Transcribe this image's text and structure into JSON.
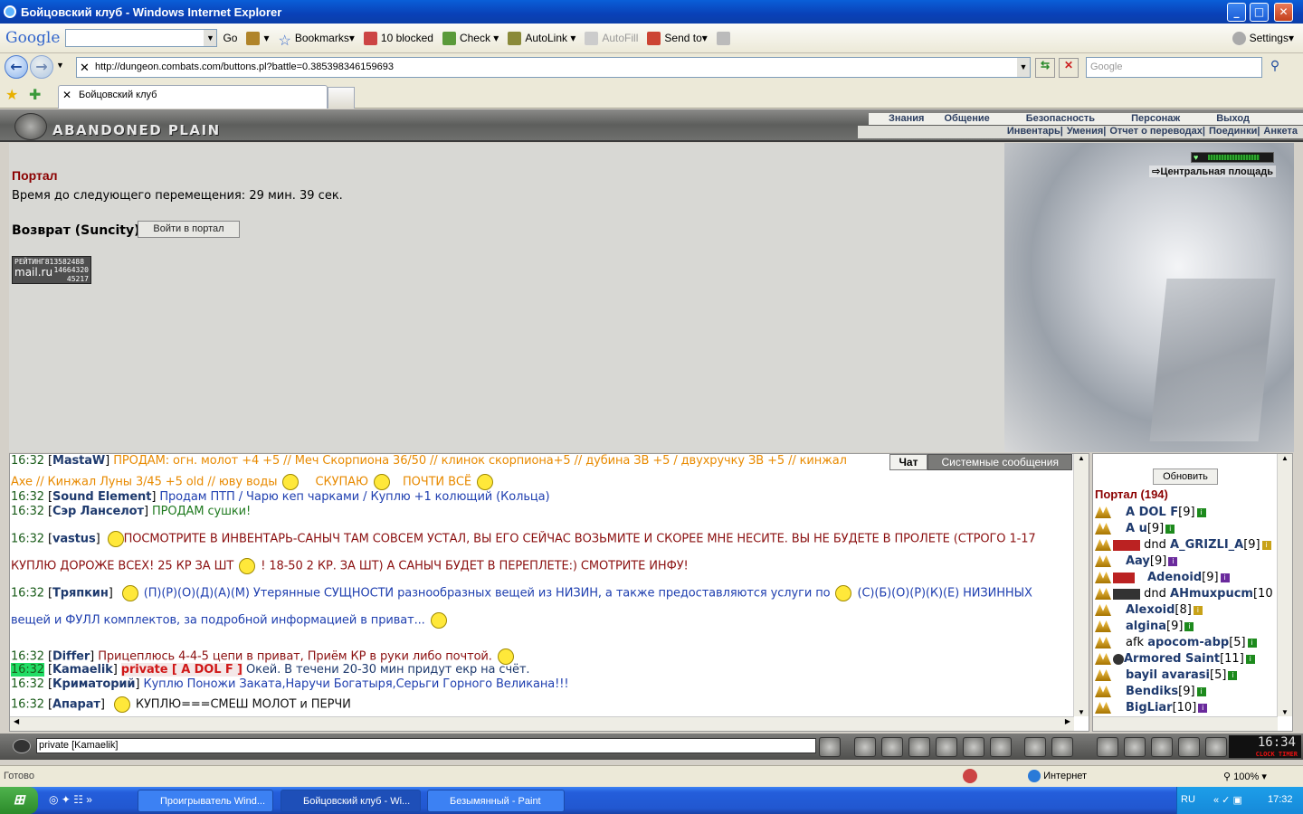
{
  "window": {
    "title": "Бойцовский клуб - Windows Internet Explorer"
  },
  "google_toolbar": {
    "logo": "Google",
    "go": "Go",
    "bookmarks": "Bookmarks",
    "blocked": "10 blocked",
    "check": "Check",
    "autolink": "AutoLink",
    "autofill": "AutoFill",
    "sendto": "Send to",
    "settings": "Settings"
  },
  "address": {
    "url": "http://dungeon.combats.com/buttons.pl?battle=0.385398346159693",
    "search_placeholder": "Google"
  },
  "tabs": [
    {
      "label": "Бойцовский клуб"
    }
  ],
  "game": {
    "logo": "ABANDONED PLAIN",
    "menu_top": [
      "Знания",
      "Общение",
      "Безопасность",
      "Персонаж",
      "Выход"
    ],
    "menu_sub": [
      "Инвентарь",
      "Умения",
      "Отчет о переводах",
      "Поединки",
      "Анкета"
    ],
    "portal_title": "Портал",
    "timer_text": "Время до следующего перемещения: 29 мин. 39 сек.",
    "return_label": "Возврат (Suncity)",
    "enter_button": "Войти в портал",
    "central_link": "Центральная площадь",
    "rating": {
      "line1": "РЕЙТИНГ",
      "n1": "813582488",
      "brand": "mail.ru",
      "n2": "14664320",
      "n3": "45217"
    },
    "hp_fraction": 0.82
  },
  "chat": {
    "tabs": [
      "Чат",
      "Системные сообщения"
    ],
    "lines": [
      {
        "time": "16:32",
        "nick": "MastaW",
        "text": "ПРОДАМ: огн. молот +4 +5 // Меч Скорпиона 36/50 // клинок скорпиона+5 // дубина ЗВ +5 / двухручку ЗВ +5 // кинжал"
      },
      {
        "time": "",
        "nick": "",
        "text": "Axe // Кинжал Луны 3/45 +5 old // юву воды",
        "text2": "СКУПАЮ",
        "text3": "ПОЧТИ ВСЁ"
      },
      {
        "time": "16:32",
        "nick": "Sound Element",
        "text": "Продам ПТП / Чарю кеп чарками / Куплю +1 колющий (Кольца)"
      },
      {
        "time": "16:32",
        "nick": "Сэр Ланселот",
        "text": "ПРОДАМ сушки!"
      },
      {
        "time": "16:32",
        "nick": "vastus",
        "text": "ПОСМОТРИТЕ В ИНВЕНТАРЬ-САНЫЧ ТАМ СОВСЕМ УСТАЛ, ВЫ ЕГО СЕЙЧАС ВОЗЬМИТЕ И СКОРЕЕ МНЕ НЕСИТЕ. ВЫ НЕ БУДЕТЕ В ПРОЛЕТЕ (СТРОГО 1-17"
      },
      {
        "time": "",
        "nick": "",
        "text": "КУПЛЮ ДОРОЖЕ ВСЕХ! 25 КР ЗА ШТ",
        "text2": "! 18-50 2 КР. ЗА ШТ) А САНЫЧ БУДЕТ В ПЕРЕПЛЕТЕ:) СМОТРИТЕ ИНФУ!"
      },
      {
        "time": "16:32",
        "nick": "Тряпкин",
        "text": "(П)(Р)(О)(Д)(А)(М) Утерянные СУЩНОСТИ разнообразных вещей из НИЗИН, а также предоставляются услуги по",
        "text2": "(С)(Б)(О)(Р)(К)(Е) НИЗИННЫХ"
      },
      {
        "time": "",
        "nick": "",
        "text": "вещей и ФУЛЛ комплектов, за подробной информацией в приват..."
      },
      {
        "time": "16:32",
        "nick": "Differ",
        "text": "Прицеплюсь 4-4-5 цепи в приват, Приём КР в руки либо почтой."
      },
      {
        "time": "16:32",
        "nick": "Kamaelik",
        "private": "private [ A DOL F ]",
        "text": "Окей. В течени 20-30 мин придут екр на счёт."
      },
      {
        "time": "16:32",
        "nick": "Криматорий",
        "text": "Куплю Поножи Заката,Наручи Богатыря,Серьги Горного Великана!!!"
      },
      {
        "time": "16:32",
        "nick": "Апарат",
        "text": "КУПЛЮ===СМЕШ МОЛОТ и ПЕРЧИ"
      }
    ],
    "input_value": "private [Kamaelik]"
  },
  "users": {
    "refresh": "Обновить",
    "room": "Портал (194)",
    "list": [
      {
        "prefix": "",
        "name": "A DOL F",
        "level": "[9]",
        "info": "g"
      },
      {
        "prefix": "",
        "name": "A u",
        "level": "[9]",
        "info": "g"
      },
      {
        "prefix": "dnd",
        "name": "A_GRIZLI_A",
        "level": "[9]",
        "info": "y"
      },
      {
        "prefix": "",
        "name": "Aay",
        "level": "[9]",
        "info": "p"
      },
      {
        "prefix": "",
        "name": "Adenoid",
        "level": "[9]",
        "info": "p"
      },
      {
        "prefix": "dnd",
        "name": "AHmuxpucm",
        "level": "[10",
        "info": ""
      },
      {
        "prefix": "",
        "name": "Alexoid",
        "level": "[8]",
        "info": "y"
      },
      {
        "prefix": "",
        "name": "algina",
        "level": "[9]",
        "info": "g"
      },
      {
        "prefix": "afk",
        "name": "apocom-abp",
        "level": "[5]",
        "info": "g"
      },
      {
        "prefix": "",
        "name": "Armored Saint",
        "level": "[11]",
        "info": "g"
      },
      {
        "prefix": "",
        "name": "bayil avarasi",
        "level": "[5]",
        "info": "g"
      },
      {
        "prefix": "",
        "name": "Bendiks",
        "level": "[9]",
        "info": "g"
      },
      {
        "prefix": "",
        "name": "BigLiar",
        "level": "[10]",
        "info": "p"
      }
    ]
  },
  "clock": {
    "time": "16:34",
    "label": "CLOCK TIMER"
  },
  "statusbar": {
    "left": "Готово",
    "zone": "Интернет",
    "zoom": "100%"
  },
  "taskbar": {
    "start": "",
    "tasks": [
      "Проигрыватель Wind...",
      "Бойцовский клуб - Wi...",
      "Безымянный - Paint"
    ],
    "lang": "RU",
    "time": "17:32"
  },
  "colors": {
    "time_green": "#1a5c1a",
    "nick": "#1e3a6e",
    "orange": "#e88a00",
    "maroon": "#8b0000",
    "green_msg": "#1f7a1f",
    "blue_msg": "#2040b0"
  }
}
